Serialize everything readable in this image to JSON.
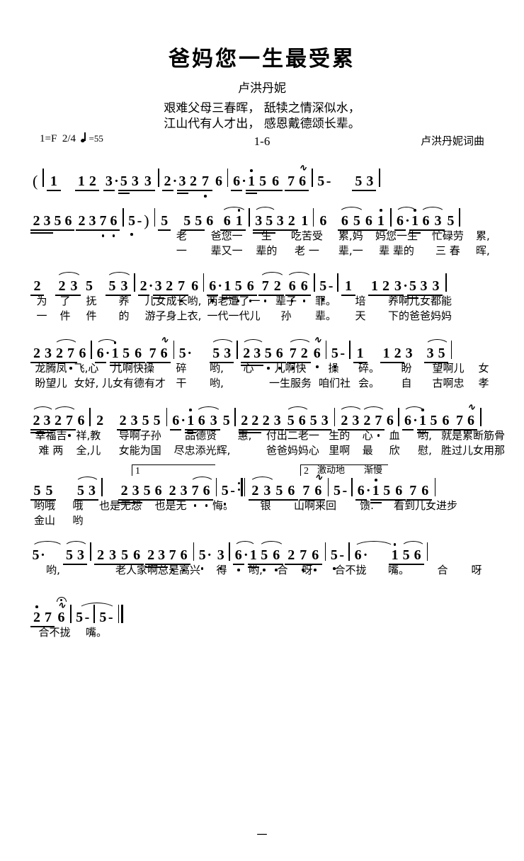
{
  "header": {
    "title": "爸妈您一生最受累",
    "performer": "卢洪丹妮",
    "epigraph_line1": "艰难父母三春晖， 舐犊之情深似水，",
    "epigraph_line2": "江山代有人才出， 感恩戴德颂长辈。"
  },
  "meta": {
    "key": "1=F",
    "time_signature": "2/4",
    "tempo_value": "=55",
    "section_label": "1-6",
    "credit": "卢洪丹妮词曲"
  },
  "expression": {
    "excited": "激动地",
    "slowing": "渐慢"
  },
  "volta": {
    "first": "1",
    "second": "2"
  },
  "page_number": "一",
  "chart_data": {
    "type": "table",
    "title": "爸妈您一生最受累 — 简谱 (jianpu numbered notation)",
    "key": "1=F",
    "time_signature": "2/4",
    "tempo_bpm": 55,
    "systems": [
      {
        "index": 1,
        "notes": "( | 1  1 2 3.5 3 3 | 2.3 2 7. 6 | 6.1 5 6 7 6~ | 5 -   5 3 |",
        "lyrics_1": "",
        "lyrics_2": ""
      },
      {
        "index": 2,
        "notes": "2 3 5 6 2 3 7. 6. | 5 - ) | 5  5 5 6  6 i | 3 5 3 2 1 | 6  6 5 6 i | 6.1 6 3 5 |",
        "lyrics_1": "老 爸您一 生  吃苦受 累,妈 妈您一生 忙碌劳 累,",
        "lyrics_2": "一 辈又一 辈的 老 一 辈,一 辈 辈的 三 春 晖,"
      },
      {
        "index": 3,
        "notes": "2  2 3 5  5 3 | 2.3 2 7. 6 | 6.1 5 6 7 2 6 6 | 5 - | 1  1 2 3.5 3 3 |",
        "lyrics_1": "为 了 抚 养   儿女成长哟,两老遭了一 辈子 罪。 培 养啊儿女都能",
        "lyrics_2": "一 件 件 的   游子身上衣,一代一代儿 孙 辈。 天 下的爸爸妈妈"
      },
      {
        "index": 4,
        "notes": "2 3 2 7. 6 | 6.1 5 6 7 6~ | 5.  5 3 | 2 3 5 6 7 2 6~ | 5 - | 1  1 2 3  3 5 |",
        "lyrics_1": "龙腾凤 飞,心 儿啊快操 碎  哟, 心 儿啊快 操  碎。 盼 望啊儿 女",
        "lyrics_2": "盼望儿女好,儿女有德有才 干  哟, 一生服务咱们社 会。 自 古啊忠 孝"
      },
      {
        "index": 5,
        "notes": "2 3 2 7. 6 | 2  2 3 5 5 | 6.1 6 3 5 | 2 2 2 3 5 6 5 3 | 2 3 2 7. 6 | 6.1 5 6 7 6~ |",
        "lyrics_1": "幸福吉 祥,教 导啊子孙 品德贤 惠,付出二老一 生的 心 血 哟,就是累断筋骨",
        "lyrics_2": "难 两 全,儿 女能为国 尽忠添光辉,爸爸妈妈心 里啊 最 欣 慰,胜过儿女用那"
      },
      {
        "index": 6,
        "notes": "5 5  5 3 | [1.] 2 3 5 6 2 3 7. 6. | 5 - :|| [2.] 2 3 5 6 7 6~ | 5 - | 6.1 5 6 7 6 |",
        "lyrics_1": "哟哦 哦  也是无怨也是无 悔。 银 山啊来回 馈. 看到儿女进步",
        "lyrics_2": "金山 哟"
      },
      {
        "index": 7,
        "notes": "5.  5 3 | 2 3 5 6 2.3 7. 6. | 5. 3. | 6.1 5 6 2 7 6. | 5 - | 6.   i 5 6 |",
        "lyrics_1": "哟,  老人家啊总是高兴 得 哟,合 呀 合不拢 嘴。 合  呀",
        "lyrics_2": ""
      },
      {
        "index": 8,
        "notes": "2. 7 6~ | 5 - | 5 - ||",
        "lyrics_1": "合不拢 嘴。",
        "lyrics_2": ""
      }
    ]
  }
}
